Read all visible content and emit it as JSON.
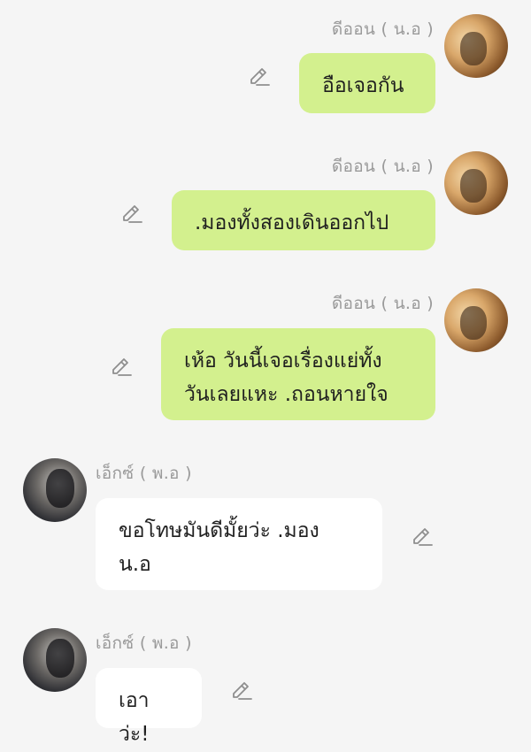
{
  "messages": [
    {
      "sender": "ดีออน ( น.อ )",
      "side": "out",
      "text": "อือเจอกัน"
    },
    {
      "sender": "ดีออน ( น.อ )",
      "side": "out",
      "text": ".มองทั้งสองเดินออกไป"
    },
    {
      "sender": "ดีออน ( น.อ )",
      "side": "out",
      "text_line1": "เห้อ วันนี้เจอเรื่องแย่ทั้ง",
      "text_line2": "วันเลยแหะ .ถอนหายใจ"
    },
    {
      "sender": "เอ็กซ์ ( พ.อ )",
      "side": "in",
      "text_line1": "ขอโทษมันดีมั้ยว่ะ .มอง",
      "text_line2": "น.อ"
    },
    {
      "sender": "เอ็กซ์ ( พ.อ )",
      "side": "in",
      "text": "เอาว่ะ!"
    }
  ],
  "colors": {
    "outgoing_bubble": "#d3f08e",
    "incoming_bubble": "#ffffff",
    "background": "#f5f5f5",
    "name_text": "#9a9a9a"
  },
  "icons": {
    "edit": "pencil-icon",
    "avatar_out": "avatar-deon",
    "avatar_in": "avatar-ex"
  }
}
